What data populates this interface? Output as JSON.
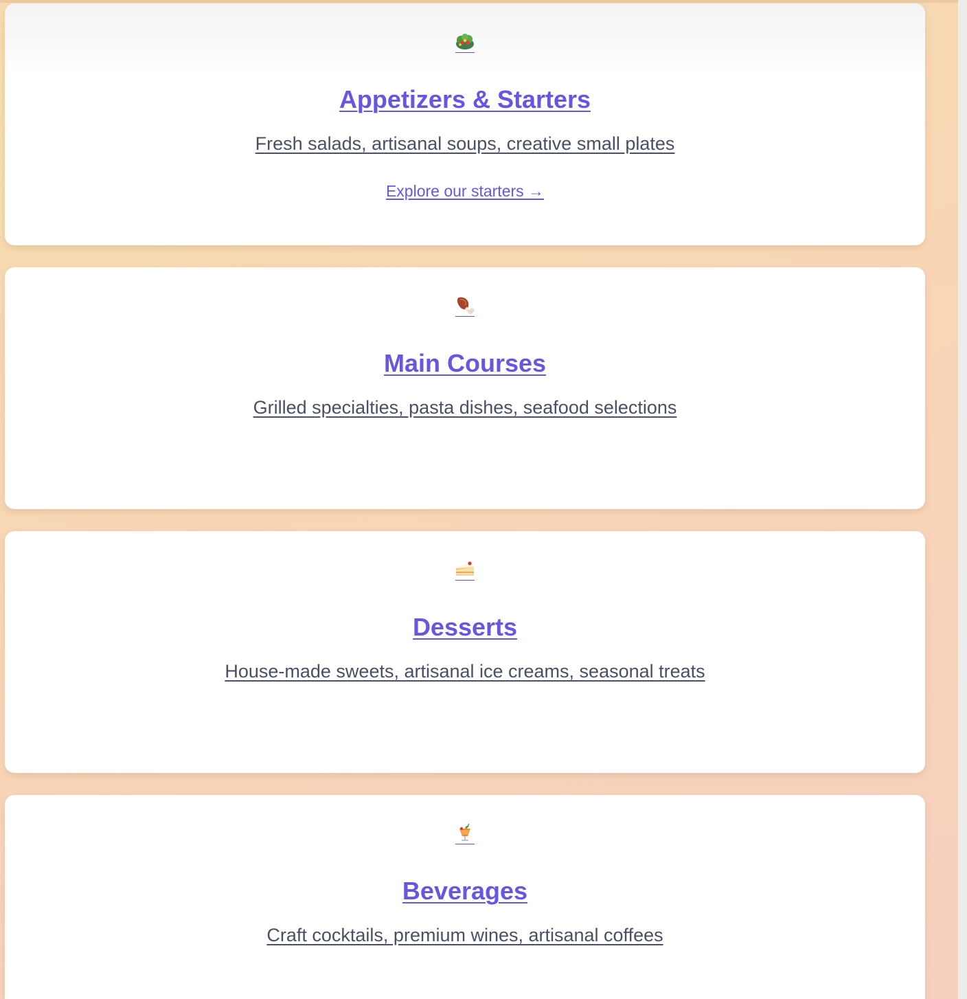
{
  "colors": {
    "title": "#6557e0",
    "description": "#4a4f63",
    "card_background": "#ffffff",
    "page_gradient_start": "#f7dcae",
    "page_gradient_end": "#f7d0c0"
  },
  "categories": [
    {
      "icon": "salad-icon",
      "title": "Appetizers & Starters",
      "description": "Fresh salads, artisanal soups, creative small plates",
      "cta": "Explore our starters →"
    },
    {
      "icon": "meat-on-bone-icon",
      "title": "Main Courses",
      "description": "Grilled specialties, pasta dishes, seafood selections",
      "cta": ""
    },
    {
      "icon": "cake-slice-icon",
      "title": "Desserts",
      "description": "House-made sweets, artisanal ice creams, seasonal treats",
      "cta": ""
    },
    {
      "icon": "tropical-drink-icon",
      "title": "Beverages",
      "description": "Craft cocktails, premium wines, artisanal coffees",
      "cta": ""
    }
  ]
}
